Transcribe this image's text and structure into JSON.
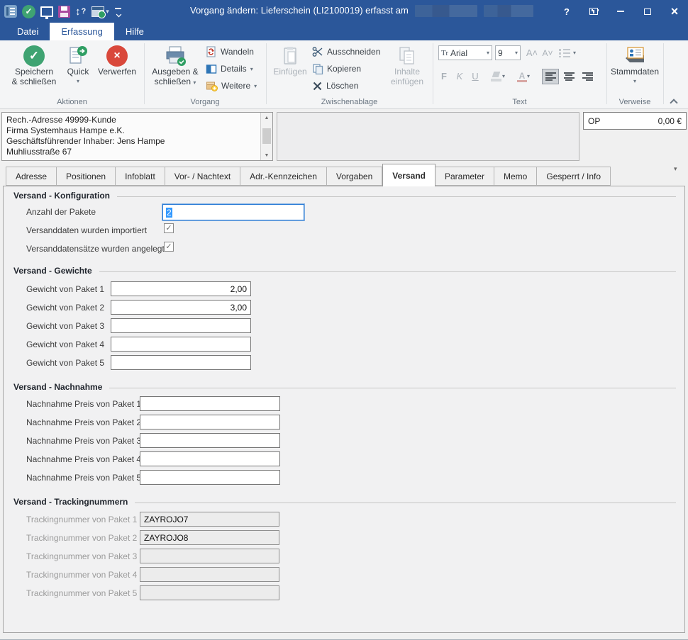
{
  "window": {
    "title": "Vorgang ändern: Lieferschein (LI2100019) erfasst am"
  },
  "icons": {
    "dropdown": "▾",
    "check": "✓",
    "close": "×",
    "help": "?",
    "updown": "↕",
    "arrow_up": "▲",
    "arrow_down": "▼",
    "font_tr": "Tr"
  },
  "colors": {
    "titlebar_blue": "#2b579a",
    "focus_blue": "#2b7cd6",
    "selection_blue": "#3399ff",
    "save_green": "#3fa372",
    "discard_red": "#d9483b"
  },
  "menubar": {
    "items": [
      {
        "label": "Datei"
      },
      {
        "label": "Erfassung"
      },
      {
        "label": "Hilfe"
      }
    ],
    "active": "Erfassung"
  },
  "ribbon": {
    "aktionen": {
      "label": "Aktionen",
      "speichern1": "Speichern",
      "speichern2": "& schließen",
      "quick": "Quick",
      "verwerfen": "Verwerfen"
    },
    "vorgang": {
      "label": "Vorgang",
      "ausgeben1": "Ausgeben &",
      "ausgeben2": "schließen",
      "wandeln": "Wandeln",
      "details": "Details",
      "weitere": "Weitere"
    },
    "zwischenablage": {
      "label": "Zwischenablage",
      "einfuegen": "Einfügen",
      "ausschneiden": "Ausschneiden",
      "kopieren": "Kopieren",
      "loeschen": "Löschen",
      "inhalte1": "Inhalte",
      "inhalte2": "einfügen"
    },
    "text": {
      "label": "Text",
      "font": "Arial",
      "size": "9",
      "bold": "F",
      "italic": "K",
      "underline": "U",
      "color_letter": "A"
    },
    "verweise": {
      "label": "Verweise",
      "stammdaten": "Stammdaten"
    }
  },
  "header": {
    "address_lines": [
      "Rech.-Adresse 49999-Kunde",
      "Firma Systemhaus Hampe e.K.",
      "Geschäftsführender Inhaber: Jens Hampe",
      "Muhliusstraße 67"
    ],
    "op_label": "OP",
    "op_value": "0,00 €"
  },
  "tabs": {
    "labels": [
      "Adresse",
      "Positionen",
      "Infoblatt",
      "Vor- / Nachtext",
      "Adr.-Kennzeichen",
      "Vorgaben",
      "Versand",
      "Parameter",
      "Memo",
      "Gesperrt / Info"
    ],
    "active": "Versand"
  },
  "form": {
    "konfiguration": {
      "title": "Versand - Konfiguration",
      "anzahl_label": "Anzahl der Pakete",
      "anzahl_value": "2",
      "importiert_label": "Versanddaten wurden importiert",
      "importiert_checked": true,
      "angelegt_label": "Versanddatensätze wurden angelegt",
      "angelegt_checked": true
    },
    "gewichte": {
      "title": "Versand - Gewichte",
      "rows": [
        {
          "label": "Gewicht von Paket 1",
          "value": "2,00"
        },
        {
          "label": "Gewicht von Paket 2",
          "value": "3,00"
        },
        {
          "label": "Gewicht von Paket 3",
          "value": ""
        },
        {
          "label": "Gewicht von Paket 4",
          "value": ""
        },
        {
          "label": "Gewicht von Paket 5",
          "value": ""
        }
      ]
    },
    "nachnahme": {
      "title": "Versand - Nachnahme",
      "rows": [
        {
          "label": "Nachnahme Preis von Paket 1",
          "value": ""
        },
        {
          "label": "Nachnahme Preis von Paket 2",
          "value": ""
        },
        {
          "label": "Nachnahme Preis von Paket 3",
          "value": ""
        },
        {
          "label": "Nachnahme Preis von Paket 4",
          "value": ""
        },
        {
          "label": "Nachnahme Preis von Paket 5",
          "value": ""
        }
      ]
    },
    "tracking": {
      "title": "Versand - Trackingnummern",
      "rows": [
        {
          "label": "Trackingnummer von Paket 1",
          "value": "ZAYROJO7"
        },
        {
          "label": "Trackingnummer von Paket 2",
          "value": "ZAYROJO8"
        },
        {
          "label": "Trackingnummer von Paket 3",
          "value": ""
        },
        {
          "label": "Trackingnummer von Paket 4",
          "value": ""
        },
        {
          "label": "Trackingnummer von Paket 5",
          "value": ""
        }
      ]
    }
  }
}
